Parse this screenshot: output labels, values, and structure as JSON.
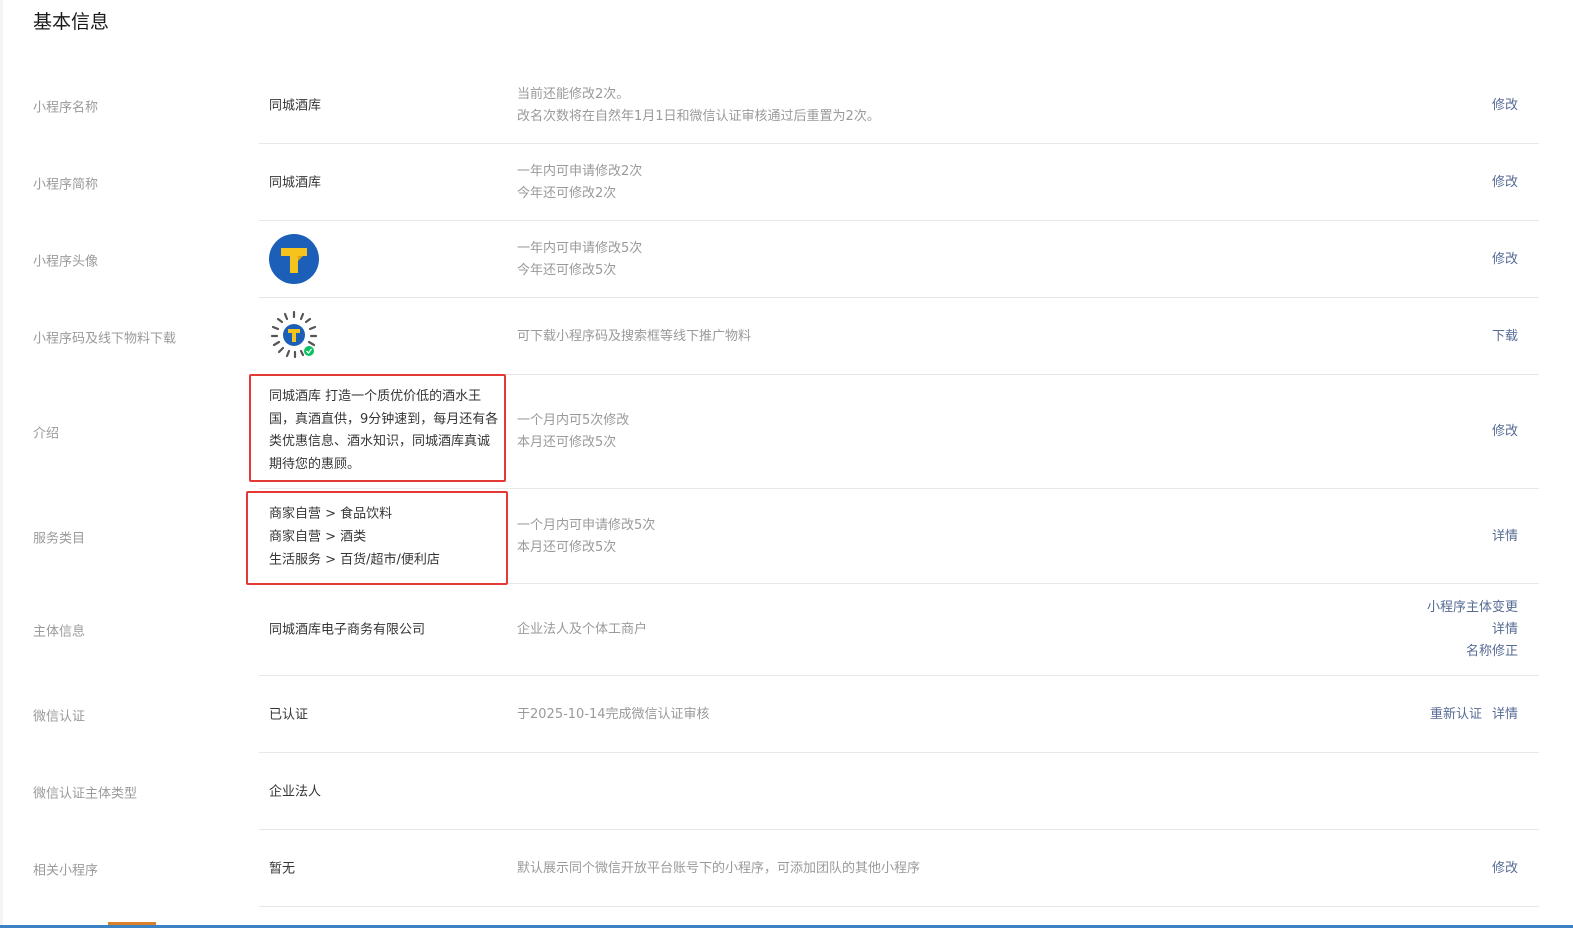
{
  "page_title": "基本信息",
  "rows": {
    "name": {
      "label": "小程序名称",
      "value": "同城酒库",
      "desc": [
        "当前还能修改2次。",
        "改名次数将在自然年1月1日和微信认证审核通过后重置为2次。"
      ],
      "action": "修改"
    },
    "short_name": {
      "label": "小程序简称",
      "value": "同城酒库",
      "desc": [
        "一年内可申请修改2次",
        "今年还可修改2次"
      ],
      "action": "修改"
    },
    "avatar": {
      "label": "小程序头像",
      "desc": [
        "一年内可申请修改5次",
        "今年还可修改5次"
      ],
      "action": "修改",
      "icon": "mini-program-logo-icon",
      "colors": {
        "ring": "#1c5fb8",
        "letter": "#f6c21c"
      }
    },
    "qrcode": {
      "label": "小程序码及线下物料下载",
      "desc": [
        "可下载小程序码及搜索框等线下推广物料"
      ],
      "action": "下载",
      "icon": "mini-program-code-icon"
    },
    "intro": {
      "label": "介绍",
      "value": "同城酒库 打造一个质优价低的酒水王国，真酒直供，9分钟速到，每月还有各类优惠信息、酒水知识，同城酒库真诚期待您的惠顾。",
      "desc": [
        "一个月内可5次修改",
        "本月还可修改5次"
      ],
      "action": "修改"
    },
    "category": {
      "label": "服务类目",
      "values": [
        "商家自营 > 食品饮料",
        "商家自营 > 酒类",
        "生活服务 > 百货/超市/便利店"
      ],
      "desc": [
        "一个月内可申请修改5次",
        "本月还可修改5次"
      ],
      "action": "详情"
    },
    "entity": {
      "label": "主体信息",
      "value": "同城酒库电子商务有限公司",
      "desc": [
        "企业法人及个体工商户"
      ],
      "actions": [
        "小程序主体变更",
        "详情",
        "名称修正"
      ]
    },
    "wechat_cert": {
      "label": "微信认证",
      "value": "已认证",
      "desc": [
        "于2025-10-14完成微信认证审核"
      ],
      "actions": [
        "重新认证",
        "详情"
      ]
    },
    "cert_type": {
      "label": "微信认证主体类型",
      "value": "企业法人"
    },
    "related": {
      "label": "相关小程序",
      "value": "暂无",
      "desc": [
        "默认展示同个微信开放平台账号下的小程序，可添加团队的其他小程序"
      ],
      "action": "修改"
    }
  },
  "theme": {
    "link": "#576b95",
    "highlight_border": "#e53935"
  }
}
